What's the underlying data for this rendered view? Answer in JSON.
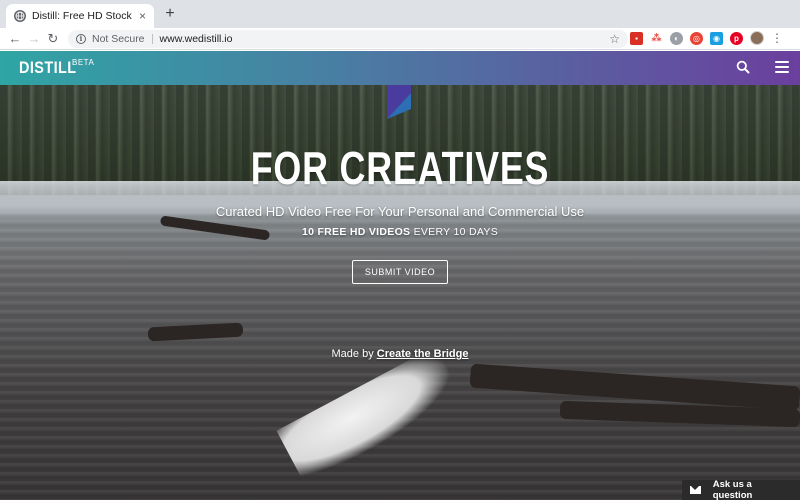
{
  "browser": {
    "tab_title": "Distill: Free HD Stock Video & ",
    "tab_close": "×",
    "new_tab": "+",
    "security_label": "Not Secure",
    "url": "www.wedistill.io"
  },
  "site": {
    "logo": "DISTILL",
    "beta": "BETA"
  },
  "hero": {
    "title": "FOR CREATIVES",
    "subtitle": "Curated HD Video Free For Your Personal and Commercial Use",
    "count_bold": "10 FREE HD VIDEOS",
    "count_rest": " EVERY 10 DAYS",
    "submit_label": "SUBMIT VIDEO",
    "made_by_prefix": "Made by ",
    "made_by_link": "Create the Bridge"
  },
  "chat": {
    "label": "Ask us a question"
  },
  "colors": {
    "header_gradient_start": "#2fa5a4",
    "header_gradient_end": "#6b3f9e"
  }
}
